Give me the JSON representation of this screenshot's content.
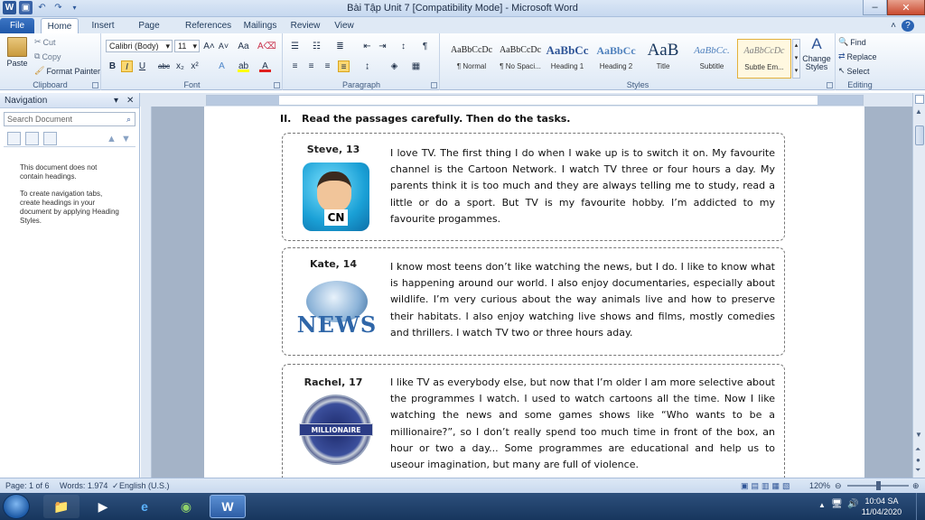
{
  "window": {
    "title": "Bài Tập Unit 7 [Compatibility Mode] - Microsoft Word",
    "app_icon_letter": "W"
  },
  "tabs": [
    "File",
    "Home",
    "Insert",
    "Page Layout",
    "References",
    "Mailings",
    "Review",
    "View"
  ],
  "ribbon": {
    "clipboard": {
      "label": "Clipboard",
      "paste": "Paste",
      "cut": "Cut",
      "copy": "Copy",
      "format_painter": "Format Painter"
    },
    "font": {
      "label": "Font",
      "font_name": "Calibri (Body)",
      "font_size": "11"
    },
    "paragraph": {
      "label": "Paragraph"
    },
    "styles": {
      "label": "Styles",
      "items": [
        {
          "preview": "AaBbCcDc",
          "name": "¶ Normal"
        },
        {
          "preview": "AaBbCcDc",
          "name": "¶ No Spaci..."
        },
        {
          "preview": "AaBbCc",
          "name": "Heading 1"
        },
        {
          "preview": "AaBbCc",
          "name": "Heading 2"
        },
        {
          "preview": "AaB",
          "name": "Title"
        },
        {
          "preview": "AaBbCc.",
          "name": "Subtitle"
        },
        {
          "preview": "AaBbCcDc",
          "name": "Subtle Em..."
        }
      ],
      "change_styles": "Change Styles"
    },
    "editing": {
      "label": "Editing",
      "find": "Find",
      "replace": "Replace",
      "select": "Select"
    }
  },
  "navigation": {
    "title": "Navigation",
    "search_placeholder": "Search Document",
    "msg1": "This document does not contain headings.",
    "msg2": "To create navigation tabs, create headings in your document by applying Heading Styles."
  },
  "document": {
    "section_number": "II.",
    "section_title": "Read the passages carefully. Then do the tasks.",
    "passages": [
      {
        "name": "Steve, 13",
        "image": "cartoon-network-logo",
        "logo_text": "CN",
        "text": "I love TV. The first thing I do when I wake up is to switch it on. My favourite channel is the Cartoon Network. I watch TV three or four hours a day. My parents think it is too much and they are always telling me to study, read a little or do a sport. But TV is my favourite hobby. I’m addicted to my favourite progammes."
      },
      {
        "name": "Kate, 14",
        "image": "news-globe-logo",
        "logo_text": "NEWS",
        "text": "I know most teens don’t like watching the news, but I do. I like to know what is happening around our world. I also enjoy documentaries, especially about wildlife. I’m very curious about the way animals live and how to preserve their habitats. I also enjoy watching live shows and films, mostly comedies and thrillers. I watch TV two or three hours aday."
      },
      {
        "name": "Rachel, 17",
        "image": "millionaire-logo",
        "logo_text": "MILLIONAIRE",
        "text": "I like TV as everybody else, but now that I’m older I am more selective about the programmes I watch. I used to watch cartoons all the time. Now I like watching the news and some games shows like “Who wants to be a millionaire?”, so I don’t really spend too much time in front of the box, an hour or two a day... Some programmes are educational and help us to useour imagination, but many are full of violence."
      }
    ]
  },
  "status": {
    "page": "Page: 1 of 6",
    "words": "Words: 1.974",
    "language": "English (U.S.)",
    "zoom": "120%"
  },
  "taskbar": {
    "time": "10:04 SA",
    "date": "11/04/2020"
  },
  "colors": {
    "word_blue": "#2b579a",
    "file_tab": "#2a63b3",
    "taskbar": "#1d3e6b"
  }
}
